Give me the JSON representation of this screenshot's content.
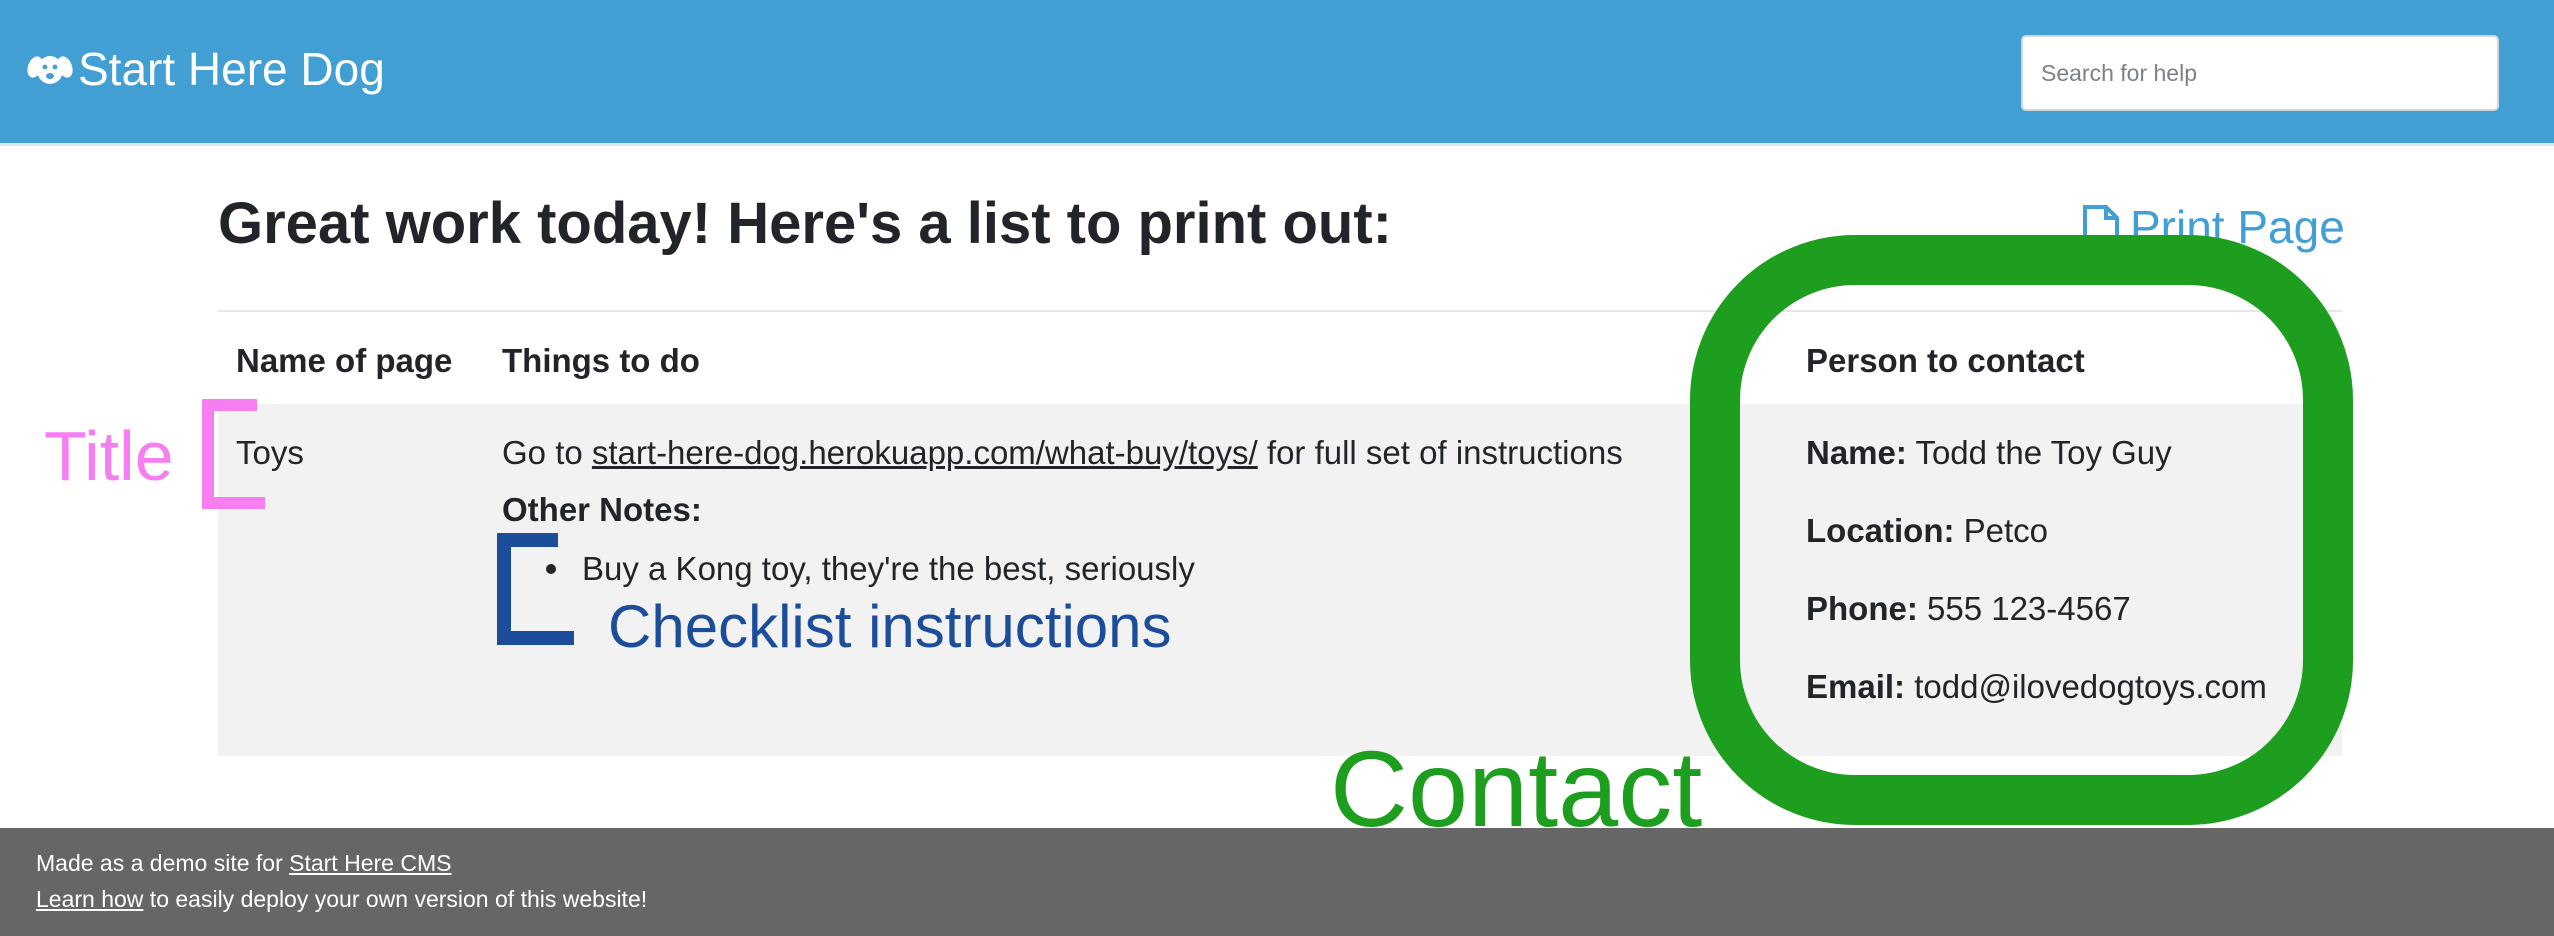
{
  "navbar": {
    "brand": "Start Here Dog",
    "search_placeholder": "Search for help"
  },
  "page": {
    "heading": "Great work today! Here's a list to print out:",
    "print_label": "Print Page"
  },
  "table": {
    "headers": [
      "Name of page",
      "Things to do",
      "Person to contact"
    ],
    "row": {
      "name": "Toys",
      "todo_prefix": "Go to ",
      "todo_link": "start-here-dog.herokuapp.com/what-buy/toys/",
      "todo_suffix": " for full set of instructions",
      "notes_label": "Other Notes:",
      "notes": [
        "Buy a Kong toy, they're the best, seriously"
      ],
      "contact": [
        {
          "label": "Name:",
          "value": " Todd the Toy Guy"
        },
        {
          "label": "Location:",
          "value": " Petco"
        },
        {
          "label": "Phone:",
          "value": " 555 123-4567"
        },
        {
          "label": "Email:",
          "value": " todd@ilovedogtoys.com"
        }
      ]
    }
  },
  "footer": {
    "line1_text": "Made as a demo site for ",
    "line1_link": "Start Here CMS",
    "line2_link": "Learn how",
    "line2_text": " to easily deploy your own version of this website!"
  },
  "annotations": {
    "title": "Title",
    "checklist": "Checklist instructions",
    "contact": "Contact",
    "colors": {
      "title": "#f77ef0",
      "checklist": "#1c4d9b",
      "contact": "#1e9e1e"
    }
  }
}
